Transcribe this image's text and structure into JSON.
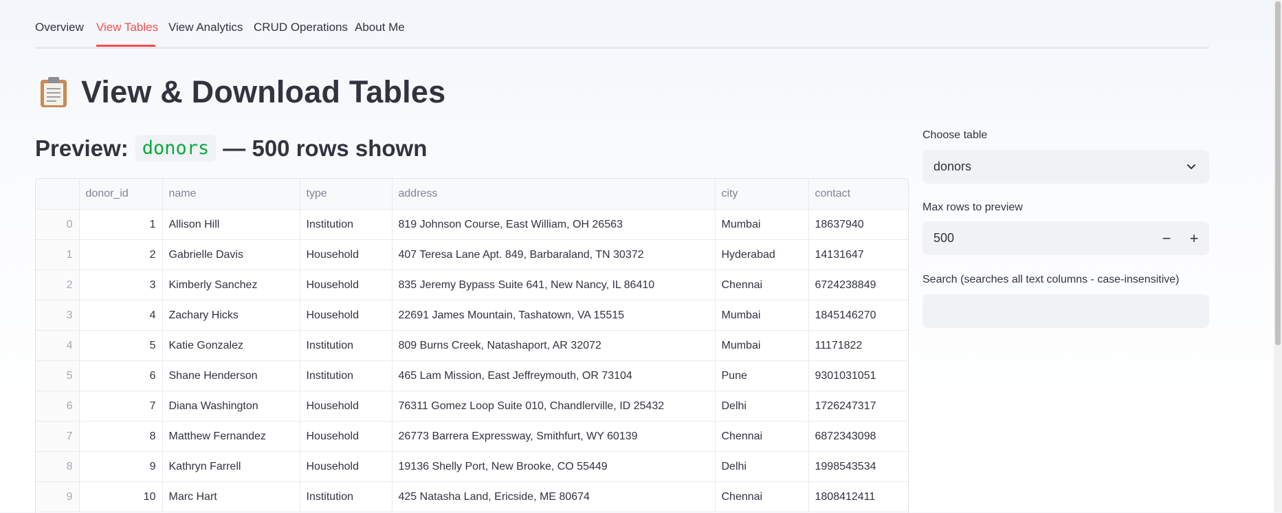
{
  "nav": {
    "tabs": [
      {
        "label": "Overview",
        "active": false
      },
      {
        "label": "View Tables",
        "active": true
      },
      {
        "label": "View Analytics",
        "active": false
      },
      {
        "label": "CRUD Operations",
        "active": false
      },
      {
        "label": "About Me",
        "active": false
      }
    ]
  },
  "page": {
    "title_icon": "clipboard-icon",
    "title": "View & Download Tables"
  },
  "preview": {
    "prefix": "Preview:",
    "table_name": "donors",
    "suffix": "— 500 rows shown"
  },
  "table": {
    "columns": [
      "",
      "donor_id",
      "name",
      "type",
      "address",
      "city",
      "contact"
    ],
    "rows": [
      [
        "0",
        "1",
        "Allison Hill",
        "Institution",
        "819 Johnson Course, East William, OH 26563",
        "Mumbai",
        "18637940"
      ],
      [
        "1",
        "2",
        "Gabrielle Davis",
        "Household",
        "407 Teresa Lane Apt. 849, Barbaraland, TN 30372",
        "Hyderabad",
        "14131647"
      ],
      [
        "2",
        "3",
        "Kimberly Sanchez",
        "Household",
        "835 Jeremy Bypass Suite 641, New Nancy, IL 86410",
        "Chennai",
        "6724238849"
      ],
      [
        "3",
        "4",
        "Zachary Hicks",
        "Household",
        "22691 James Mountain, Tashatown, VA 15515",
        "Mumbai",
        "1845146270"
      ],
      [
        "4",
        "5",
        "Katie Gonzalez",
        "Institution",
        "809 Burns Creek, Natashaport, AR 32072",
        "Mumbai",
        "11171822"
      ],
      [
        "5",
        "6",
        "Shane Henderson",
        "Institution",
        "465 Lam Mission, East Jeffreymouth, OR 73104",
        "Pune",
        "9301031051"
      ],
      [
        "6",
        "7",
        "Diana Washington",
        "Household",
        "76311 Gomez Loop Suite 010, Chandlerville, ID 25432",
        "Delhi",
        "1726247317"
      ],
      [
        "7",
        "8",
        "Matthew Fernandez",
        "Household",
        "26773 Barrera Expressway, Smithfurt, WY 60139",
        "Chennai",
        "6872343098"
      ],
      [
        "8",
        "9",
        "Kathryn Farrell",
        "Household",
        "19136 Shelly Port, New Brooke, CO 55449",
        "Delhi",
        "1998543534"
      ],
      [
        "9",
        "10",
        "Marc Hart",
        "Institution",
        "425 Natasha Land, Ericside, ME 80674",
        "Chennai",
        "1808412411"
      ]
    ]
  },
  "controls": {
    "choose_table_label": "Choose table",
    "choose_table_value": "donors",
    "max_rows_label": "Max rows to preview",
    "max_rows_value": "500",
    "minus": "−",
    "plus": "+",
    "search_label": "Search (searches all text columns - case-insensitive)",
    "search_value": ""
  },
  "colors": {
    "accent": "#ff4b4b",
    "code_text": "#09ab3b",
    "input_bg": "#f0f2f6"
  }
}
